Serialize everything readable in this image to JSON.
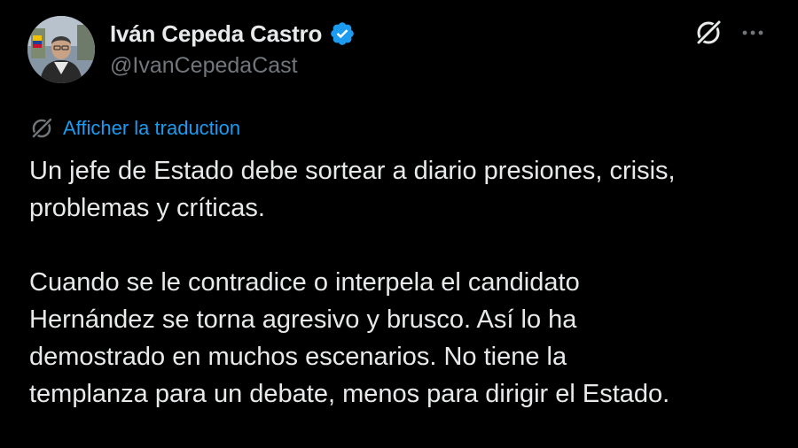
{
  "author": {
    "display_name": "Iván Cepeda Castro",
    "handle": "@IvanCepedaCast",
    "verified": true
  },
  "icons": {
    "avatar": "profile-photo",
    "verified": "verified-badge-icon",
    "grok": "grok-icon",
    "more": "more-options-icon",
    "translate": "grok-translate-icon"
  },
  "translate": {
    "label": "Afficher la traduction"
  },
  "tweet": {
    "paragraphs": [
      "Un jefe de Estado debe sortear a diario presiones, crisis,\nproblemas y críticas.",
      "Cuando se le contradice o interpela el candidato\nHernández se torna agresivo y brusco. Así lo ha\ndemostrado en muchos escenarios. No tiene la\ntemplanza para un debate, menos para dirigir el Estado."
    ]
  },
  "colors": {
    "background": "#000000",
    "text": "#e7e9ea",
    "secondary": "#71767b",
    "accent": "#1d9bf0"
  }
}
